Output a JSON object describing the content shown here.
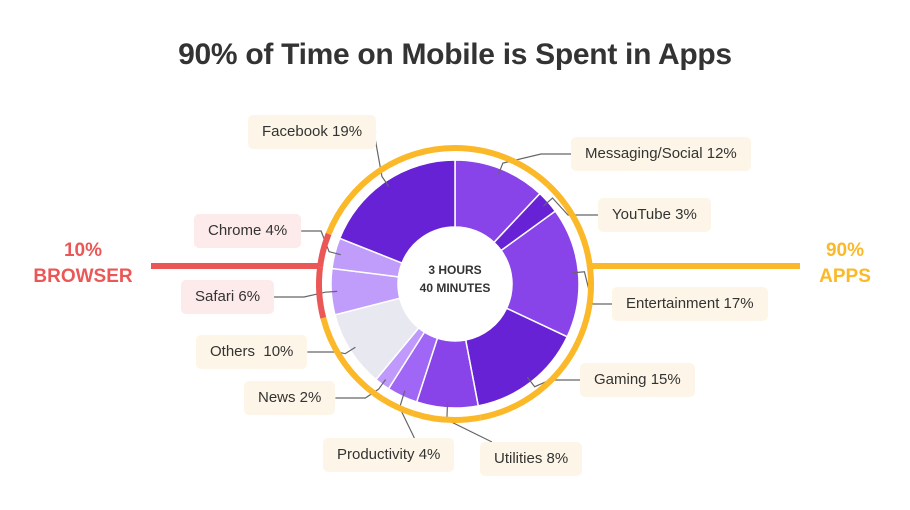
{
  "chart_data": {
    "type": "pie",
    "variant": "donut",
    "title": "90% of Time on Mobile is Spent in Apps",
    "center_label": [
      "3 HOURS",
      "40 MINUTES"
    ],
    "start": "top, clockwise",
    "slices": [
      {
        "label": "Messaging/Social",
        "value": 12,
        "text": "Messaging/Social 12%",
        "group": "apps",
        "color": "#8844e8"
      },
      {
        "label": "YouTube",
        "value": 3,
        "text": "YouTube 3%",
        "group": "apps",
        "color": "#6622d4"
      },
      {
        "label": "Entertainment",
        "value": 17,
        "text": "Entertainment 17%",
        "group": "apps",
        "color": "#8844e8"
      },
      {
        "label": "Gaming",
        "value": 15,
        "text": "Gaming 15%",
        "group": "apps",
        "color": "#6622d4"
      },
      {
        "label": "Utilities",
        "value": 8,
        "text": "Utilities 8%",
        "group": "apps",
        "color": "#8844e8"
      },
      {
        "label": "Productivity",
        "value": 4,
        "text": "Productivity 4%",
        "group": "apps",
        "color": "#a066f5"
      },
      {
        "label": "News",
        "value": 2,
        "text": "News 2%",
        "group": "apps",
        "color": "#bf99fb"
      },
      {
        "label": "Others",
        "value": 10,
        "text": "Others  10%",
        "group": "apps",
        "color": "#e8e8f0"
      },
      {
        "label": "Safari",
        "value": 6,
        "text": "Safari 6%",
        "group": "browser",
        "color": "#c09cfb"
      },
      {
        "label": "Chrome",
        "value": 4,
        "text": "Chrome 4%",
        "group": "browser",
        "color": "#c09cfb"
      },
      {
        "label": "Facebook",
        "value": 19,
        "text": "Facebook 19%",
        "group": "apps",
        "color": "#6622d4"
      }
    ],
    "groups": [
      {
        "key": "apps",
        "pct": "90%",
        "name": "APPS",
        "color": "#fbb929",
        "side": "right"
      },
      {
        "key": "browser",
        "pct": "10%",
        "name": "BROWSER",
        "color": "#eb5757",
        "side": "left"
      }
    ],
    "legend": "none (callout labels)"
  }
}
